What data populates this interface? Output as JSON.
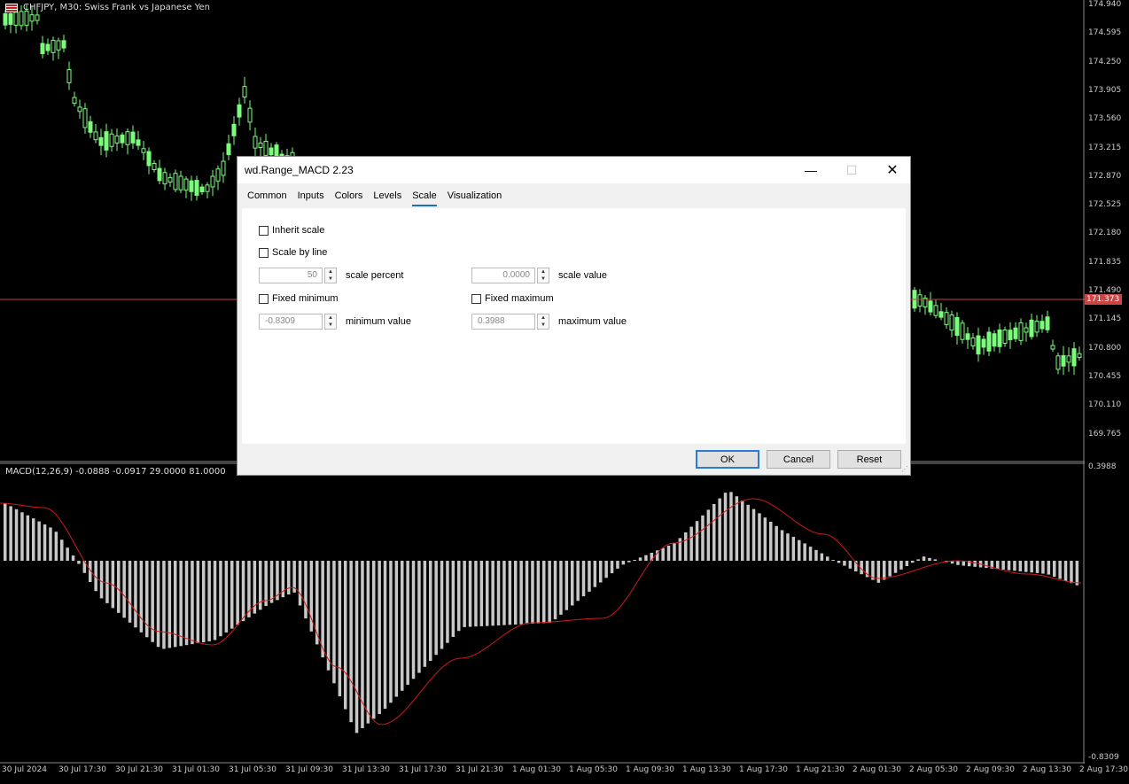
{
  "chart": {
    "symbol_title": "CHFJPY, M30:  Swiss Frank vs Japanese Yen",
    "indicator_label": "MACD(12,26,9) -0.0888 -0.0917 29.0000 81.0000",
    "current_price": "171.373",
    "price_ticks": [
      "174.940",
      "174.595",
      "174.250",
      "173.905",
      "173.560",
      "173.215",
      "172.870",
      "172.525",
      "172.180",
      "171.835",
      "171.490",
      "171.145",
      "170.800",
      "170.455",
      "170.110",
      "169.765"
    ],
    "macd_max": "0.3988",
    "macd_min": "-0.8309",
    "time_ticks": [
      "30 Jul 2024",
      "30 Jul 17:30",
      "30 Jul 21:30",
      "31 Jul 01:30",
      "31 Jul 05:30",
      "31 Jul 09:30",
      "31 Jul 13:30",
      "31 Jul 17:30",
      "31 Jul 21:30",
      "1 Aug 01:30",
      "1 Aug 05:30",
      "1 Aug 09:30",
      "1 Aug 13:30",
      "1 Aug 17:30",
      "1 Aug 21:30",
      "2 Aug 01:30",
      "2 Aug 05:30",
      "2 Aug 09:30",
      "2 Aug 13:30",
      "2 Aug 17:30"
    ],
    "colors": {
      "bull": "#7cfc7c",
      "bear": "#000000",
      "histogram": "#c8c8c8",
      "signal": "#d01a1a",
      "price_line": "#c44444"
    }
  },
  "dialog": {
    "title": "wd.Range_MACD 2.23",
    "window_buttons": {
      "minimize": "—",
      "maximize": "☐",
      "close": "✕"
    },
    "tabs": [
      {
        "label": "Common",
        "active": false
      },
      {
        "label": "Inputs",
        "active": false
      },
      {
        "label": "Colors",
        "active": false
      },
      {
        "label": "Levels",
        "active": false
      },
      {
        "label": "Scale",
        "active": true
      },
      {
        "label": "Visualization",
        "active": false
      }
    ],
    "scale": {
      "inherit_scale": {
        "label": "Inherit scale",
        "checked": false
      },
      "scale_by_line": {
        "label": "Scale by line",
        "checked": false
      },
      "scale_percent": {
        "value": "50",
        "label": "scale percent"
      },
      "scale_value": {
        "value": "0.0000",
        "label": "scale value"
      },
      "fixed_minimum": {
        "label": "Fixed minimum",
        "checked": false
      },
      "fixed_maximum": {
        "label": "Fixed maximum",
        "checked": false
      },
      "minimum_value": {
        "value": "-0.8309",
        "label": "minimum value"
      },
      "maximum_value": {
        "value": "0.3988",
        "label": "maximum value"
      }
    },
    "buttons": {
      "ok": "OK",
      "cancel": "Cancel",
      "reset": "Reset"
    }
  }
}
